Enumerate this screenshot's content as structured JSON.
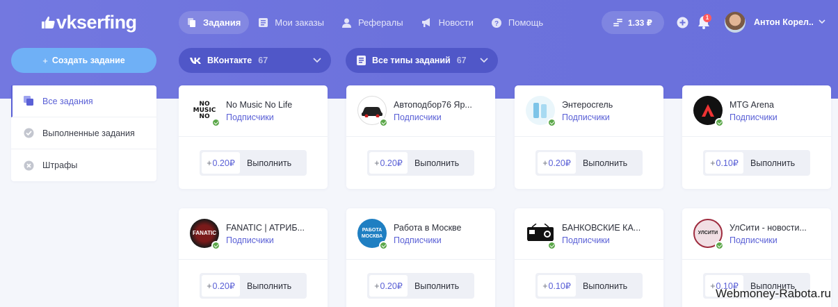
{
  "brand": {
    "logo_text": "vkserfing"
  },
  "nav": [
    {
      "label": "Задания",
      "icon": "tasks-icon",
      "active": true
    },
    {
      "label": "Мои заказы",
      "icon": "orders-icon",
      "active": false
    },
    {
      "label": "Рефералы",
      "icon": "referrals-icon",
      "active": false
    },
    {
      "label": "Новости",
      "icon": "megaphone-icon",
      "active": false
    },
    {
      "label": "Помощь",
      "icon": "help-icon",
      "active": false
    }
  ],
  "header": {
    "balance": "1.33 ₽",
    "notifications_count": "1",
    "user_name": "Антон Корел..."
  },
  "toolbar": {
    "create_label": "Создать задание",
    "network_filter": {
      "label": "ВКонтакте",
      "count": "67"
    },
    "type_filter": {
      "label": "Все типы заданий",
      "count": "67"
    }
  },
  "sidebar": {
    "items": [
      {
        "label": "Все задания",
        "active": true
      },
      {
        "label": "Выполненные задания",
        "active": false
      },
      {
        "label": "Штрафы",
        "active": false
      }
    ]
  },
  "tasks": [
    {
      "title": "No Music No Life",
      "subtitle": "Подписчики",
      "reward": "0.20₽",
      "action": "Выполнить",
      "logo_text": "NO MUSIC NO"
    },
    {
      "title": "Автоподбор76 Яр...",
      "subtitle": "Подписчики",
      "reward": "0.20₽",
      "action": "Выполнить",
      "logo_text": ""
    },
    {
      "title": "Энтеросгель",
      "subtitle": "Подписчики",
      "reward": "0.20₽",
      "action": "Выполнить",
      "logo_text": ""
    },
    {
      "title": "MTG Arena",
      "subtitle": "Подписчики",
      "reward": "0.10₽",
      "action": "Выполнить",
      "logo_text": ""
    },
    {
      "title": "FANATIC | АТРИБ...",
      "subtitle": "Подписчики",
      "reward": "0.20₽",
      "action": "Выполнить",
      "logo_text": "FANATIC"
    },
    {
      "title": "Работа в Москве",
      "subtitle": "Подписчики",
      "reward": "0.20₽",
      "action": "Выполнить",
      "logo_text": "РАБОТА МОСКВА"
    },
    {
      "title": "БАНКОВСКИЕ КА...",
      "subtitle": "Подписчики",
      "reward": "0.10₽",
      "action": "Выполнить",
      "logo_text": ""
    },
    {
      "title": "УлСити - новости...",
      "subtitle": "Подписчики",
      "reward": "0.10₽",
      "action": "Выполнить",
      "logo_text": "УЛСИТИ"
    }
  ],
  "colors": {
    "accent": "#5a60d6",
    "header_bg": "#6c72dc",
    "create_button": "#6fb0f6",
    "filter_bg": "#5057c8"
  },
  "watermark": "Webmoney-Rabota.ru"
}
